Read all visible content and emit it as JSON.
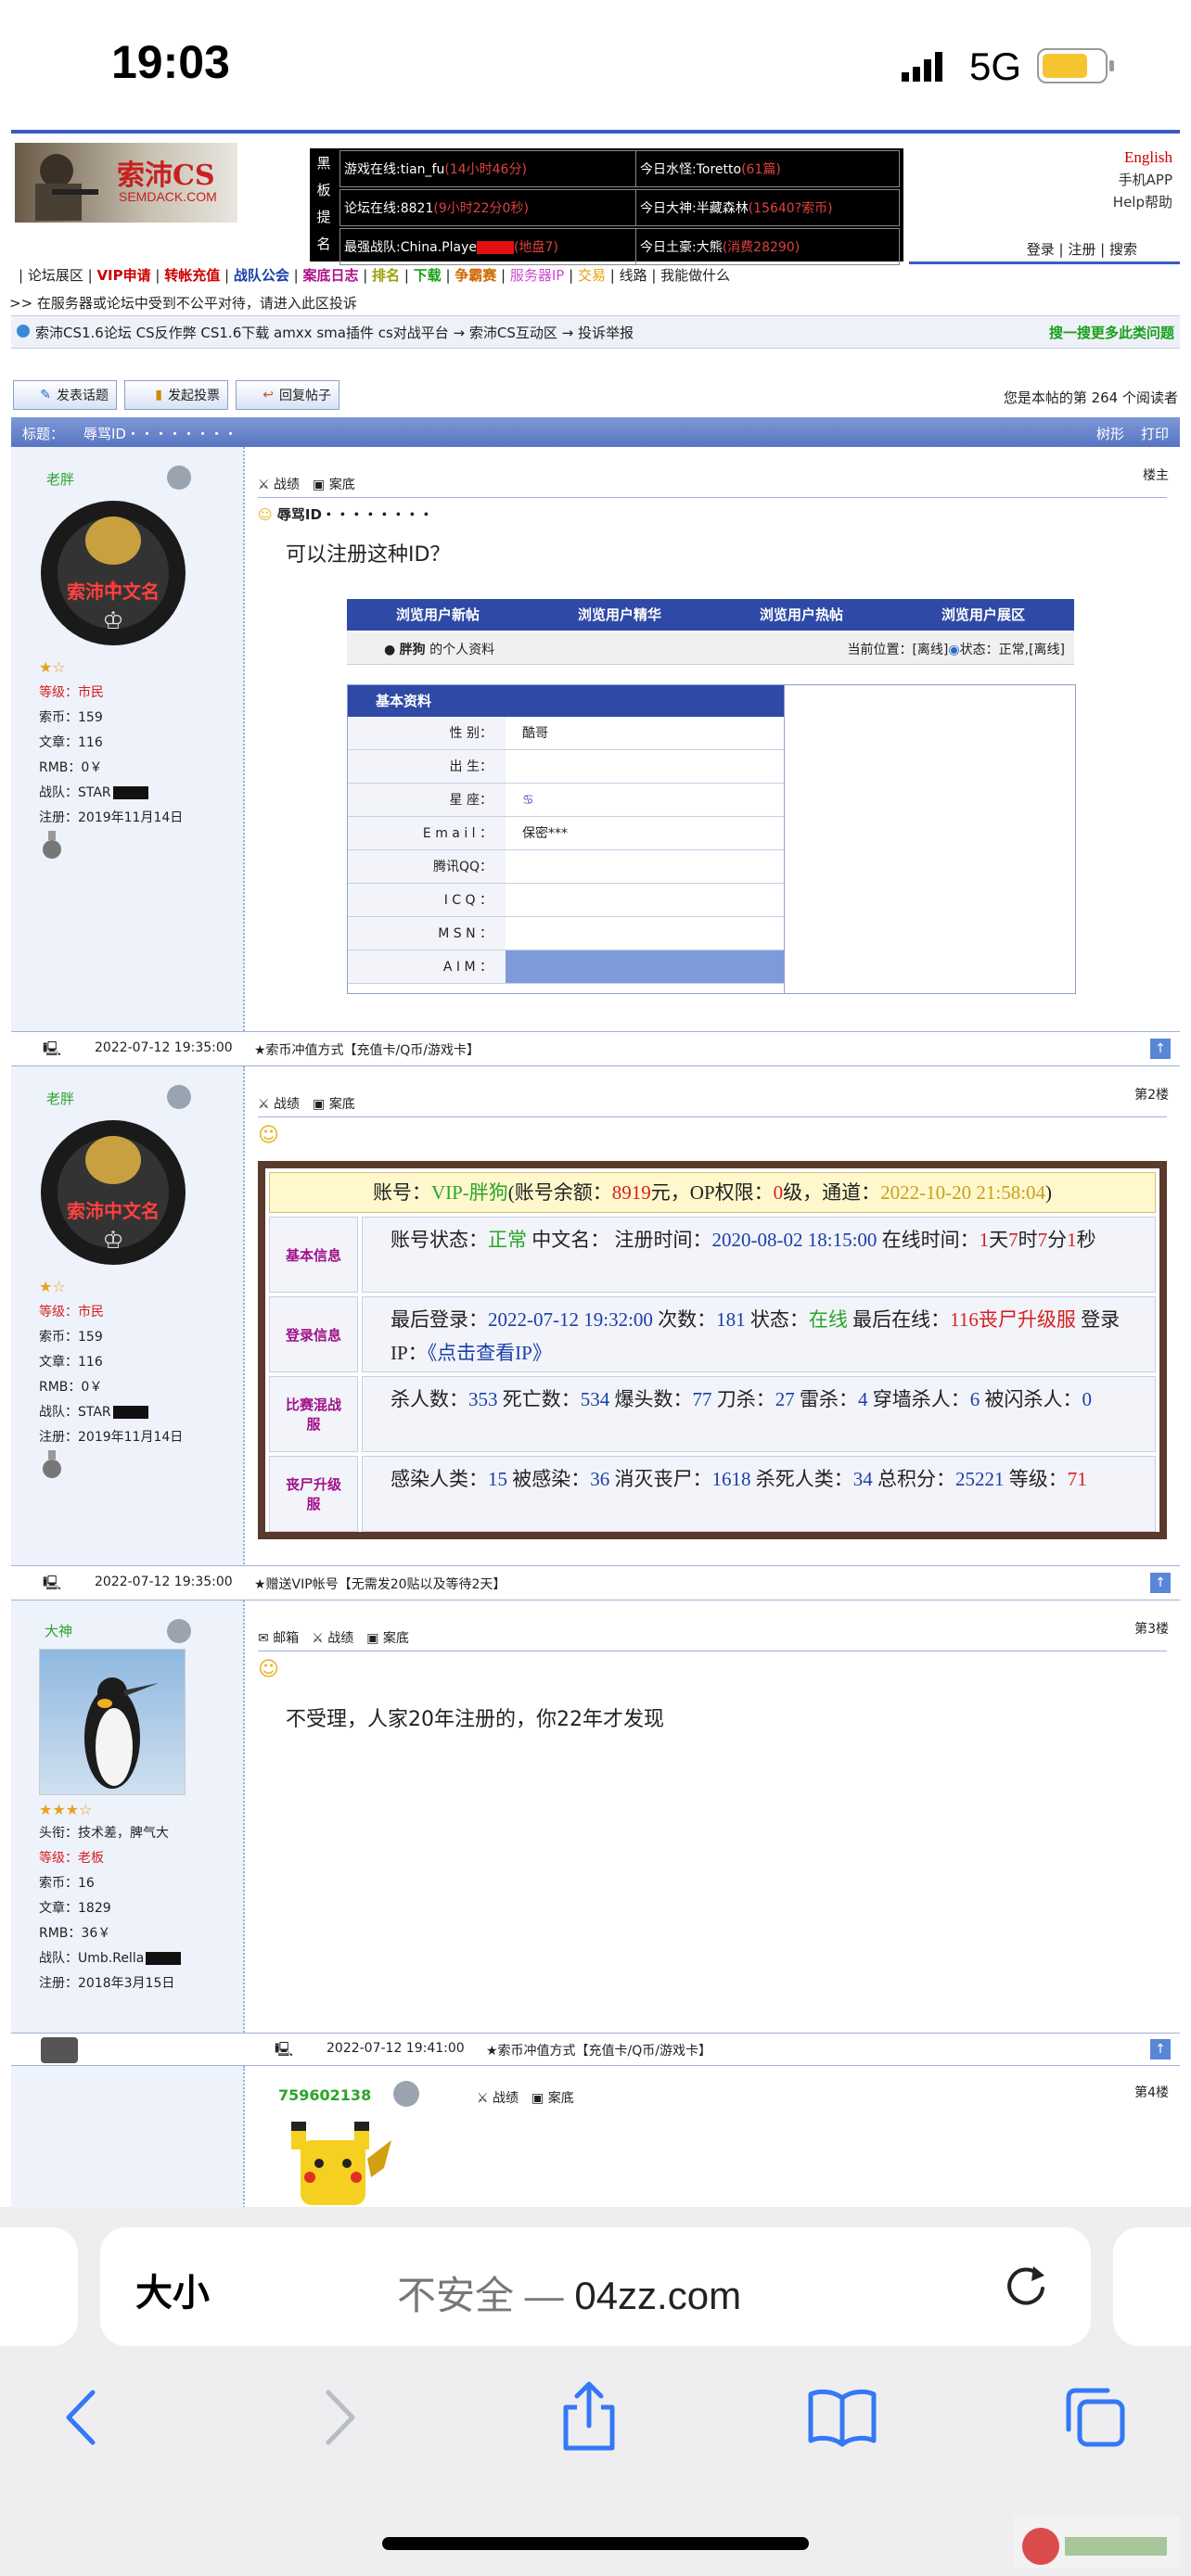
{
  "status": {
    "time": "19:03",
    "carrier": "5G"
  },
  "site": {
    "logo_text": "索沛CS",
    "logo_sub": "SEMDACK.COM",
    "board": {
      "side_label": [
        "黑",
        "板",
        "提",
        "名"
      ],
      "rows": [
        {
          "left": "游戏在线:tian_fu",
          "left_tag": "(14小时46分)",
          "right": "今日水怪:Toretto",
          "right_tag": "(61篇)"
        },
        {
          "left": "论坛在线:8821",
          "left_tag": "(9小时22分0秒)",
          "right": "今日大神:半藏森林",
          "right_tag": "(15640?索币)"
        },
        {
          "left": "最强战队:China.Playe",
          "left_tag": "(地盘7)",
          "right": "今日土豪:大熊",
          "right_tag": "(消费28290)"
        }
      ]
    },
    "top_right": [
      "English",
      "手机APP",
      "Help帮助"
    ],
    "account_links": [
      "登录",
      "注册",
      "搜索"
    ],
    "nav": [
      "论坛展区",
      "VIP申请",
      "转帐充值",
      "战队公会",
      "案底日志",
      "排名",
      "下载",
      "争霸赛",
      "服务器IP",
      "交易",
      "线路",
      "我能做什么"
    ],
    "notice": ">> 在服务器或论坛中受到不公平对待，请进入此区投诉",
    "breadcrumb": "索沛CS1.6论坛 CS反作弊 CS1.6下载 amxx sma插件 cs对战平台 → 索沛CS互动区 → 投诉举报",
    "search_more": "搜一搜更多此类问题",
    "buttons": [
      "发表话题",
      "发起投票",
      "回复帖子"
    ],
    "readers": "您是本帖的第 264 个阅读者",
    "title_label": "标题：",
    "title": "辱骂ID・・・・・・・・",
    "tree_links": [
      "树形",
      "打印"
    ]
  },
  "posts": [
    {
      "author": "老胖",
      "avatar_text": "索沛中文名",
      "level_label": "等级：",
      "level": "市民",
      "coins": "索币：159",
      "articles": "文章：116",
      "rmb": "RMB：0￥",
      "team": "战队：STAR",
      "reg": "注册：2019年11月14日",
      "actions": [
        "战绩",
        "案底"
      ],
      "floor": "楼主",
      "title": "辱骂ID・・・・・・・・",
      "body": "可以注册这种ID？",
      "tabs": [
        "浏览用户新帖",
        "浏览用户精华",
        "浏览用户热帖",
        "浏览用户展区"
      ],
      "profile_owner": "胖狗",
      "profile_suffix": " 的个人资料",
      "position": "当前位置：[离线]",
      "state": "状态：正常,[离线]",
      "basic_header": "基本资料",
      "fields": [
        {
          "label": "性 别：",
          "value": "酷哥"
        },
        {
          "label": "出 生：",
          "value": ""
        },
        {
          "label": "星 座：",
          "value": "♋"
        },
        {
          "label": "E m a i l ：",
          "value": "保密***"
        },
        {
          "label": "腾讯QQ：",
          "value": ""
        },
        {
          "label": "I C Q ：",
          "value": ""
        },
        {
          "label": "M S N ：",
          "value": ""
        },
        {
          "label": "A I M ：",
          "value": ""
        }
      ],
      "footer_time": "2022-07-12 19:35:00",
      "footer_ad": "★索币冲值方式【充值卡/Q币/游戏卡】"
    },
    {
      "author": "老胖",
      "avatar_text": "索沛中文名",
      "level_label": "等级：",
      "level": "市民",
      "coins": "索币：159",
      "articles": "文章：116",
      "rmb": "RMB：0￥",
      "team": "战队：STAR",
      "reg": "注册：2019年11月14日",
      "actions": [
        "战绩",
        "案底"
      ],
      "floor": "第2楼",
      "account_line": {
        "p1": "账号：",
        "name": "VIP-胖狗",
        "p2": "(账号余额：",
        "bal": "8919",
        "p3": "元，OP权限：",
        "op": "0",
        "p4": "级，通道：",
        "date": "2022-10-20 21:58:04",
        "p5": ")"
      },
      "sections": [
        {
          "label": "基本信息",
          "segments": [
            {
              "t": "账号状态：",
              "c": "k"
            },
            {
              "t": "正常",
              "c": "g"
            },
            {
              "t": " 中文名： 注册时间：",
              "c": "k"
            },
            {
              "t": "2020-08-02 18:15:00",
              "c": "b"
            },
            {
              "t": " 在线时间：",
              "c": "k"
            },
            {
              "t": "1",
              "c": "r"
            },
            {
              "t": "天",
              "c": "k"
            },
            {
              "t": "7",
              "c": "r"
            },
            {
              "t": "时",
              "c": "k"
            },
            {
              "t": "7",
              "c": "r"
            },
            {
              "t": "分",
              "c": "k"
            },
            {
              "t": "1",
              "c": "r"
            },
            {
              "t": "秒",
              "c": "k"
            }
          ]
        },
        {
          "label": "登录信息",
          "segments": [
            {
              "t": "最后登录：",
              "c": "k"
            },
            {
              "t": "2022-07-12 19:32:00",
              "c": "b"
            },
            {
              "t": " 次数：",
              "c": "k"
            },
            {
              "t": "181",
              "c": "b"
            },
            {
              "t": " 状态：",
              "c": "k"
            },
            {
              "t": "在线",
              "c": "g"
            },
            {
              "t": " 最后在线：",
              "c": "k"
            },
            {
              "t": "116丧尸升级服",
              "c": "r"
            },
            {
              "t": " 登录IP：",
              "c": "k"
            },
            {
              "t": "《点击查看IP》",
              "c": "b"
            }
          ]
        },
        {
          "label": "比赛混战服",
          "segments": [
            {
              "t": "杀人数：",
              "c": "k"
            },
            {
              "t": "353",
              "c": "b"
            },
            {
              "t": " 死亡数：",
              "c": "k"
            },
            {
              "t": "534",
              "c": "b"
            },
            {
              "t": " 爆头数：",
              "c": "k"
            },
            {
              "t": "77",
              "c": "b"
            },
            {
              "t": " 刀杀：",
              "c": "k"
            },
            {
              "t": "27",
              "c": "b"
            },
            {
              "t": " 雷杀：",
              "c": "k"
            },
            {
              "t": "4",
              "c": "b"
            },
            {
              "t": " 穿墙杀人：",
              "c": "k"
            },
            {
              "t": "6",
              "c": "b"
            },
            {
              "t": " 被闪杀人：",
              "c": "k"
            },
            {
              "t": "0",
              "c": "b"
            }
          ]
        },
        {
          "label": "丧尸升级服",
          "segments": [
            {
              "t": "感染人类：",
              "c": "k"
            },
            {
              "t": "15",
              "c": "b"
            },
            {
              "t": " 被感染：",
              "c": "k"
            },
            {
              "t": "36",
              "c": "b"
            },
            {
              "t": " 消灭丧尸：",
              "c": "k"
            },
            {
              "t": "1618",
              "c": "b"
            },
            {
              "t": " 杀死人类：",
              "c": "k"
            },
            {
              "t": "34",
              "c": "b"
            },
            {
              "t": " 总积分：",
              "c": "k"
            },
            {
              "t": "25221",
              "c": "b"
            },
            {
              "t": " 等级：",
              "c": "k"
            },
            {
              "t": "71",
              "c": "r"
            }
          ]
        }
      ],
      "footer_time": "2022-07-12 19:35:00",
      "footer_ad": "★赠送VIP帐号【无需发20贴以及等待2天】"
    },
    {
      "author": "大神",
      "title_line": "头衔：技术差，脾气大",
      "level_label": "等级：",
      "level": "老板",
      "coins": "索币：16",
      "articles": "文章：1829",
      "rmb": "RMB：36￥",
      "team": "战队：Umb.Rella",
      "reg": "注册：2018年3月15日",
      "actions": [
        "邮箱",
        "战绩",
        "案底"
      ],
      "floor": "第3楼",
      "body": "不受理，人家20年注册的，你22年才发现",
      "footer_time": "2022-07-12 19:41:00",
      "footer_ad": "★索币冲值方式【充值卡/Q币/游戏卡】"
    },
    {
      "author": "759602138",
      "actions": [
        "战绩",
        "案底"
      ],
      "floor": "第4楼"
    }
  ],
  "browser": {
    "text_size": "大小",
    "url_prefix": "不安全 — ",
    "url": "04zz.com"
  },
  "colors": {
    "accent": "#3a5bbf",
    "header_blue": "#6d88cf",
    "post_bg": "#eef2fb",
    "red": "#d62020",
    "green": "#2aa52a"
  }
}
